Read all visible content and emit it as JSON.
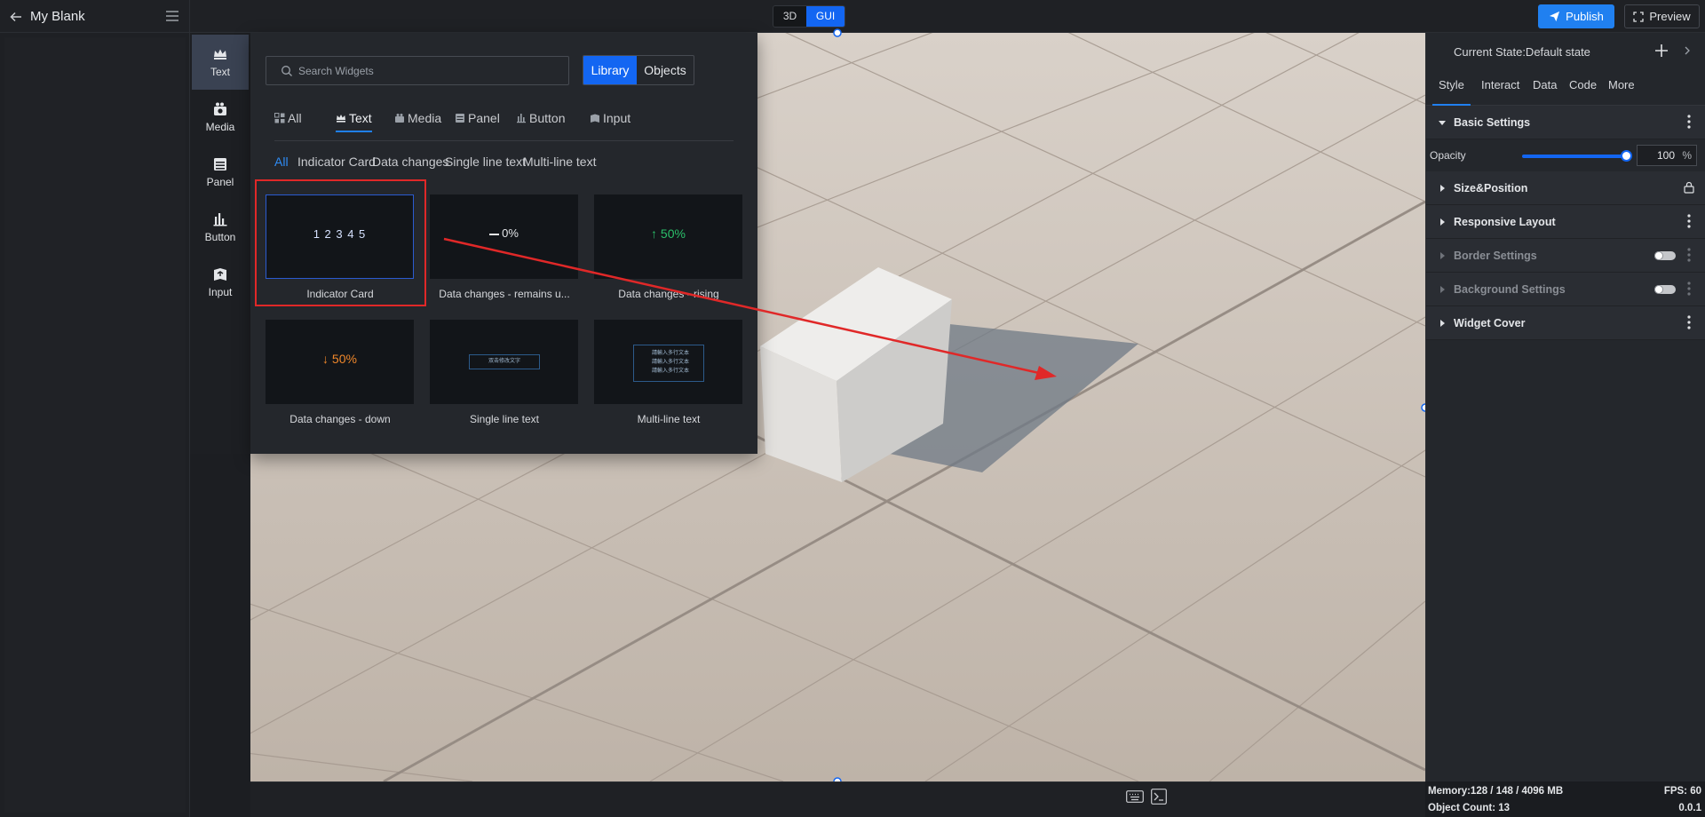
{
  "app": {
    "title": "My Blank"
  },
  "mode_toggle": {
    "options": [
      "3D",
      "GUI"
    ],
    "active": "GUI"
  },
  "header": {
    "publish_label": "Publish",
    "preview_label": "Preview"
  },
  "categories": [
    {
      "label": "Text",
      "icon": "crown-icon"
    },
    {
      "label": "Media",
      "icon": "camera-icon"
    },
    {
      "label": "Panel",
      "icon": "panel-icon"
    },
    {
      "label": "Button",
      "icon": "bars-icon"
    },
    {
      "label": "Input",
      "icon": "input-icon"
    }
  ],
  "widgets": {
    "search_placeholder": "Search Widgets",
    "library_label": "Library",
    "objects_label": "Objects",
    "type_tabs": [
      "All",
      "Text",
      "Media",
      "Panel",
      "Button",
      "Input"
    ],
    "sub_tabs": [
      "All",
      "Indicator Card",
      "Data changes",
      "Single line text",
      "Multi-line text"
    ],
    "cards": [
      {
        "label": "Indicator Card",
        "preview": "1 2 3 4 5"
      },
      {
        "label": "Data changes - remains u...",
        "preview": "0%"
      },
      {
        "label": "Data changes - rising",
        "preview": "↑ 50%"
      },
      {
        "label": "Data changes - down",
        "preview": "↓ 50%"
      },
      {
        "label": "Single line text",
        "preview": "双击修改文字"
      },
      {
        "label": "Multi-line text",
        "preview": "請輸入多行文本"
      }
    ]
  },
  "colors": {
    "accent": "#1366f2",
    "rising": "#2bbf6a",
    "down": "#f0872a",
    "selection_box": "#e02828"
  },
  "properties": {
    "current_state": "Current State:Default state",
    "tabs": [
      "Style",
      "Interact",
      "Data",
      "Code",
      "More"
    ],
    "active_tab": "Style",
    "sections": {
      "basic": "Basic Settings",
      "size_position": "Size&Position",
      "responsive": "Responsive Layout",
      "border": "Border Settings",
      "background": "Background Settings",
      "widget_cover": "Widget Cover"
    },
    "opacity_label": "Opacity",
    "opacity_value": "100",
    "opacity_unit": "%"
  },
  "status": {
    "memory": "Memory:128 / 148 / 4096 MB",
    "fps": "FPS: 60",
    "object_count": "Object Count: 13",
    "version": "0.0.1"
  }
}
